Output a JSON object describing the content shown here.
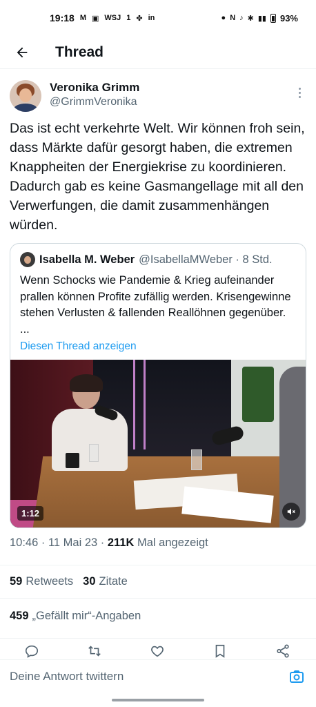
{
  "status_bar": {
    "time": "19:18",
    "left_icons": [
      "gmail-icon",
      "chat-icon",
      "wsj-icon",
      "one-icon",
      "slack-icon",
      "linkedin-icon"
    ],
    "left_labels": [
      "M",
      "WSJ",
      "1",
      "in"
    ],
    "right_icons": [
      "drop-icon",
      "nfc-icon",
      "mute-icon",
      "bluetooth-icon",
      "lte-icon",
      "battery-icon"
    ],
    "battery": "93%"
  },
  "header": {
    "title": "Thread"
  },
  "tweet": {
    "author_name": "Veronika Grimm",
    "author_handle": "@GrimmVeronika",
    "text": "Das ist echt verkehrte Welt. Wir können froh sein, dass Märkte dafür gesorgt haben, die extremen Knappheiten der Energiekrise zu koordinieren. Dadurch gab es keine Gasmangellage mit all den Verwerfungen, die damit zusammenhängen würden.",
    "timestamp": "10:46 · 11 Mai 23 ·",
    "views_count": "211K",
    "views_label": "Mal angezeigt"
  },
  "quote": {
    "author_name": "Isabella M. Weber",
    "author_handle": "@IsabellaMWeber · 8 Std.",
    "text": "Wenn Schocks wie Pandemie & Krieg aufeinander prallen können Profite zufällig werden. Krisengewinne stehen Verlusten & fallenden Reallöhnen gegenüber.\n...",
    "link": "Diesen Thread anzeigen",
    "video_duration": "1:12"
  },
  "stats": {
    "retweets_count": "59",
    "retweets_label": "Retweets",
    "quotes_count": "30",
    "quotes_label": "Zitate",
    "likes_count": "459",
    "likes_label": "„Gefällt mir“-Angaben"
  },
  "reply": {
    "placeholder": "Deine Antwort twittern"
  },
  "colors": {
    "accent": "#1d9bf0",
    "text": "#0f1419",
    "secondary": "#536471",
    "divider": "#eff3f4"
  }
}
